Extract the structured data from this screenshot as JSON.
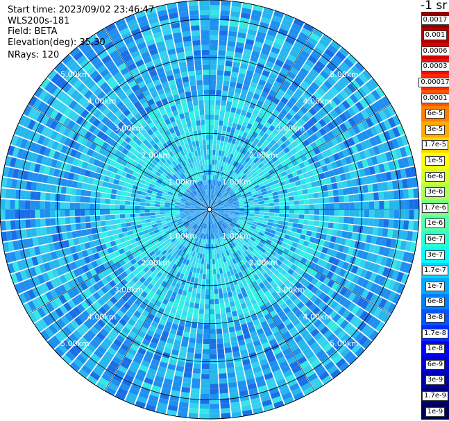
{
  "header": {
    "start_time": "Start time: 2023/09/02 23:46:47",
    "instrument": "WLS200s-181",
    "field": "Field: BETA",
    "elevation": "Elevation(deg): 35.30",
    "nrays": "NRays: 120"
  },
  "unit_label": "-1 sr",
  "range_labels": [
    "1.00km",
    "2.00km",
    "3.00km",
    "4.00km",
    "5.00km"
  ],
  "nrays": 120,
  "max_range_km": 5.5,
  "colorbar": {
    "entries": [
      {
        "label": "0.0017",
        "color": "#8b0000"
      },
      {
        "label": "0.001",
        "color": "#b20000"
      },
      {
        "label": "0.0006",
        "color": "#d40000"
      },
      {
        "label": "0.0003",
        "color": "#f01010"
      },
      {
        "label": "0.00017",
        "color": "#ff2a00"
      },
      {
        "label": "0.0001",
        "color": "#ff5500"
      },
      {
        "label": "6e-5",
        "color": "#ff7f00"
      },
      {
        "label": "3e-5",
        "color": "#ffaa00"
      },
      {
        "label": "1.7e-5",
        "color": "#ffd400"
      },
      {
        "label": "1e-5",
        "color": "#ffff00"
      },
      {
        "label": "6e-6",
        "color": "#d4ff2a"
      },
      {
        "label": "3e-6",
        "color": "#aaff55"
      },
      {
        "label": "1.7e-6",
        "color": "#7fff7f"
      },
      {
        "label": "1e-6",
        "color": "#55ffaa"
      },
      {
        "label": "6e-7",
        "color": "#2affd4"
      },
      {
        "label": "3e-7",
        "color": "#00ffff"
      },
      {
        "label": "1.7e-7",
        "color": "#00d4ff"
      },
      {
        "label": "1e-7",
        "color": "#00aaff"
      },
      {
        "label": "6e-8",
        "color": "#007fff"
      },
      {
        "label": "3e-8",
        "color": "#0055ff"
      },
      {
        "label": "1.7e-8",
        "color": "#002aff"
      },
      {
        "label": "1e-8",
        "color": "#0000ff"
      },
      {
        "label": "6e-9",
        "color": "#0000d4"
      },
      {
        "label": "3e-9",
        "color": "#0000aa"
      },
      {
        "label": "1.7e-9",
        "color": "#00007f"
      },
      {
        "label": "1e-9",
        "color": "#000055"
      }
    ]
  }
}
